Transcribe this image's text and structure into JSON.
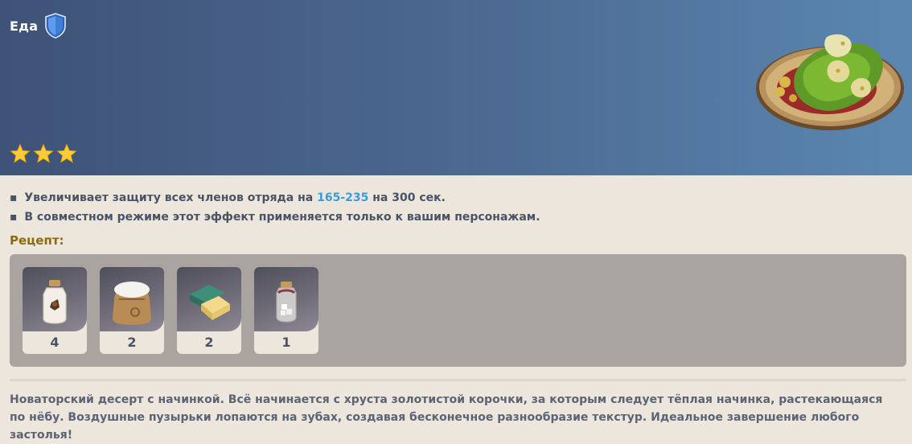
{
  "header": {
    "category": "Еда",
    "shield_icon": "shield-icon",
    "stars": 3,
    "star_icon": "star-icon",
    "dish_icon": "stuffed-pastry-dish-icon"
  },
  "effects": [
    {
      "bullet": "▪",
      "prefix": "Увеличивает защиту всех членов отряда на",
      "highlight": "165-235",
      "suffix": "на 300 сек."
    },
    {
      "bullet": "▪",
      "prefix": "В совместном режиме этот эффект применяется только к вашим персонажам.",
      "highlight": "",
      "suffix": ""
    }
  ],
  "recipe": {
    "title": "Рецепт:",
    "ingredients": [
      {
        "icon": "milk-bottle-icon",
        "count": "4"
      },
      {
        "icon": "flour-sack-icon",
        "count": "2"
      },
      {
        "icon": "butter-icon",
        "count": "2"
      },
      {
        "icon": "sugar-jar-icon",
        "count": "1"
      }
    ]
  },
  "description": "Новаторский десерт с начинкой. Всё начинается с хруста золотистой корочки, за которым следует тёплая начинка, растекающаяся по нёбу. Воздушные пузырьки лопаются на зубах, создавая бесконечное разнообразие текстур. Идеальное завершение любого застолья!",
  "colors": {
    "header_left": "#3f5277",
    "header_right": "#5a87b0",
    "highlight": "#3f9bd6",
    "recipe_title": "#8c6b0f",
    "panel": "#a9a4a0",
    "page_bg": "#ece6dd"
  }
}
